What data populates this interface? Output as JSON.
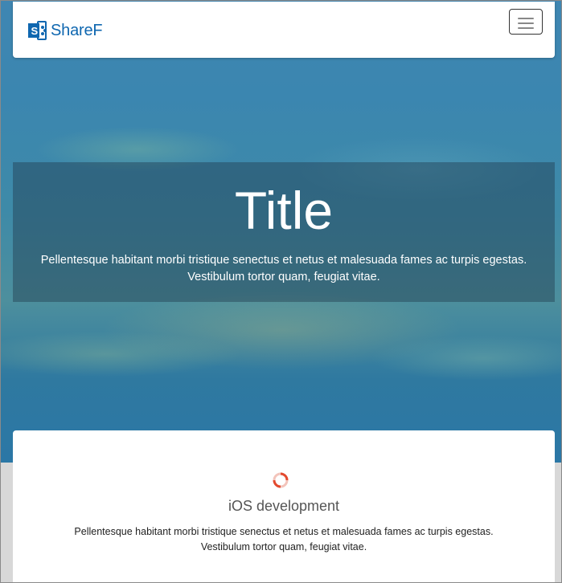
{
  "navbar": {
    "brand_text": "ShareF",
    "brand_icon": "sharepoint-logo-icon",
    "toggle_icon": "hamburger-menu-icon"
  },
  "hero": {
    "title": "Title",
    "text_line1": "Pellentesque habitant morbi tristique senectus et netus et malesuada fames ac turpis egestas.",
    "text_line2": "Vestibulum tortor quam, feugiat vitae."
  },
  "card": {
    "icon": "loading-spinner-icon",
    "title": "iOS development",
    "text_line1": "Pellentesque habitant morbi tristique senectus et netus et malesuada fames ac turpis egestas.",
    "text_line2": "Vestibulum tortor quam, feugiat vitae."
  },
  "colors": {
    "brand": "#0f67b0",
    "hero_overlay": "#1e374b",
    "spinner": "#e34a2f"
  }
}
